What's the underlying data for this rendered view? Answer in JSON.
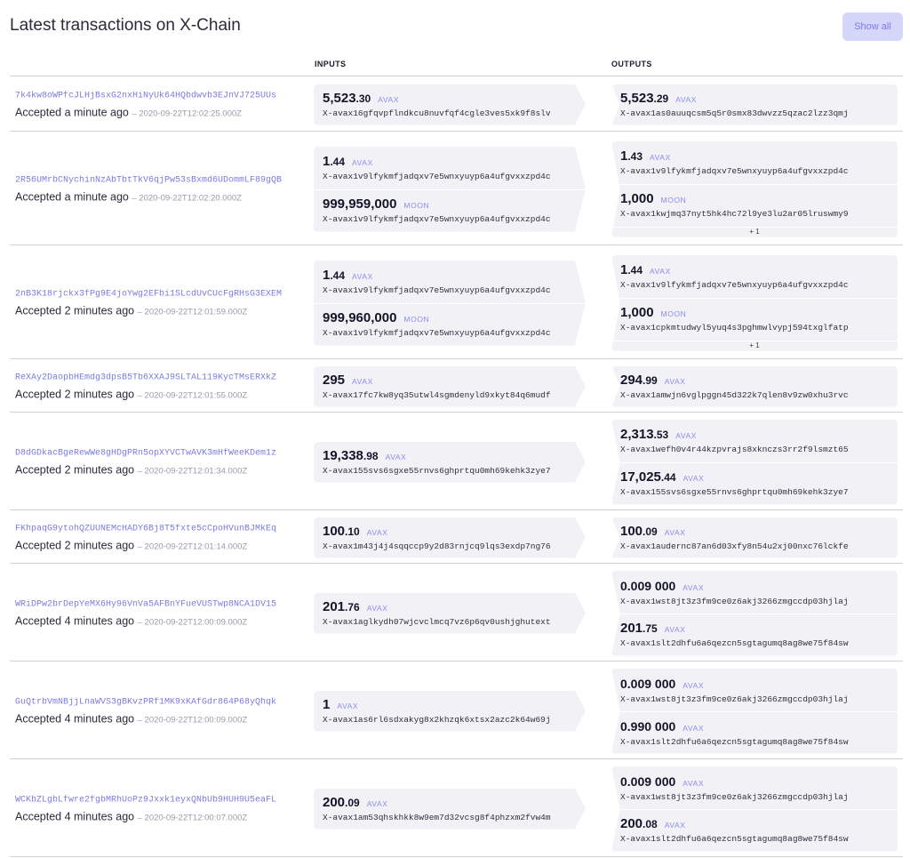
{
  "header": {
    "title": "Latest transactions on X-Chain",
    "show_all_label": "Show all"
  },
  "columns": {
    "inputs": "INPUTS",
    "outputs": "OUTPUTS"
  },
  "transactions": [
    {
      "id": "7k4kw8oWPfcJLHjBsxG2nxHiNyUk64HQbdwvb3EJnVJ725UUs",
      "status": "Accepted a minute ago",
      "timestamp": "– 2020-09-22T12:02:25.000Z",
      "inputs": [
        {
          "amount_int": "5,523",
          "amount_dec": ".30",
          "symbol": "AVAX",
          "address": "X-avax16gfqvpflndkcu8nuvfqf4cgle3ves5xk9f8slv"
        }
      ],
      "outputs": [
        {
          "amount_int": "5,523",
          "amount_dec": ".29",
          "symbol": "AVAX",
          "address": "X-avax1as0auuqcsm5q5r0smx83dwvzz5qzac2lzz3qmj"
        }
      ]
    },
    {
      "id": "2R56UMrbCNychinNzAbTbtTkV6qjPw53sBxmd6UDommLF89gQB",
      "status": "Accepted a minute ago",
      "timestamp": "– 2020-09-22T12:02:20.000Z",
      "inputs": [
        {
          "amount_int": "1",
          "amount_dec": ".44",
          "symbol": "AVAX",
          "address": "X-avax1v9lfykmfjadqxv7e5wnxyuyp6a4ufgvxxzpd4c"
        },
        {
          "amount_int": "999,959,000",
          "amount_dec": "",
          "symbol": "MOON",
          "address": "X-avax1v9lfykmfjadqxv7e5wnxyuyp6a4ufgvxxzpd4c"
        }
      ],
      "outputs": [
        {
          "amount_int": "1",
          "amount_dec": ".43",
          "symbol": "AVAX",
          "address": "X-avax1v9lfykmfjadqxv7e5wnxyuyp6a4ufgvxxzpd4c"
        },
        {
          "amount_int": "1,000",
          "amount_dec": "",
          "symbol": "MOON",
          "address": "X-avax1kwjmq37nyt5hk4hc72l9ye3lu2ar05lruswmy9"
        }
      ],
      "more_outputs": "+ 1"
    },
    {
      "id": "2nB3K18rjckx3fPg9E4joYwg2EFbi1SLcdUvCUcFgRHsG3EXEM",
      "status": "Accepted 2 minutes ago",
      "timestamp": "– 2020-09-22T12:01:59.000Z",
      "inputs": [
        {
          "amount_int": "1",
          "amount_dec": ".44",
          "symbol": "AVAX",
          "address": "X-avax1v9lfykmfjadqxv7e5wnxyuyp6a4ufgvxxzpd4c"
        },
        {
          "amount_int": "999,960,000",
          "amount_dec": "",
          "symbol": "MOON",
          "address": "X-avax1v9lfykmfjadqxv7e5wnxyuyp6a4ufgvxxzpd4c"
        }
      ],
      "outputs": [
        {
          "amount_int": "1",
          "amount_dec": ".44",
          "symbol": "AVAX",
          "address": "X-avax1v9lfykmfjadqxv7e5wnxyuyp6a4ufgvxxzpd4c"
        },
        {
          "amount_int": "1,000",
          "amount_dec": "",
          "symbol": "MOON",
          "address": "X-avax1cpkmtudwyl5yuq4s3pghmwlvypj594txglfatp"
        }
      ],
      "more_outputs": "+ 1"
    },
    {
      "id": "ReXAy2DaopbHEmdg3dpsB5Tb6XXAJ9SLTAL119KycTMsERXkZ",
      "status": "Accepted 2 minutes ago",
      "timestamp": "– 2020-09-22T12:01:55.000Z",
      "inputs": [
        {
          "amount_int": "295",
          "amount_dec": "",
          "symbol": "AVAX",
          "address": "X-avax17fc7kw8yq35utwl4sgmdenyld9xkyt84q6mudf"
        }
      ],
      "outputs": [
        {
          "amount_int": "294",
          "amount_dec": ".99",
          "symbol": "AVAX",
          "address": "X-avax1amwjn6vglpggn45d322k7qlen8v9zw0xhu3rvc"
        }
      ]
    },
    {
      "id": "D8dGDkacBgeRewWe8gHDgPRn5opXYVCTwAVK3mHfWeeKDem1z",
      "status": "Accepted 2 minutes ago",
      "timestamp": "– 2020-09-22T12:01:34.000Z",
      "inputs": [
        {
          "amount_int": "19,338",
          "amount_dec": ".98",
          "symbol": "AVAX",
          "address": "X-avax155svs6sgxe55rnvs6ghprtqu0mh69kehk3zye7"
        }
      ],
      "outputs": [
        {
          "amount_int": "2,313",
          "amount_dec": ".53",
          "symbol": "AVAX",
          "address": "X-avax1wefh0v4r44kzpvrajs8xknczs3rr2f9lsmzt65"
        },
        {
          "amount_int": "17,025",
          "amount_dec": ".44",
          "symbol": "AVAX",
          "address": "X-avax155svs6sgxe55rnvs6ghprtqu0mh69kehk3zye7"
        }
      ]
    },
    {
      "id": "FKhpaqG9ytohQZUUNEMcHADY6Bj8T5fxte5cCpoHVunBJMkEq",
      "status": "Accepted 2 minutes ago",
      "timestamp": "– 2020-09-22T12:01:14.000Z",
      "inputs": [
        {
          "amount_int": "100",
          "amount_dec": ".10",
          "symbol": "AVAX",
          "address": "X-avax1m43j4j4sqqccp9y2d83rnjcq9lqs3exdp7ng76"
        }
      ],
      "outputs": [
        {
          "amount_int": "100",
          "amount_dec": ".09",
          "symbol": "AVAX",
          "address": "X-avax1audernc87an6d03xfy8n54u2xj00nxc76lckfe"
        }
      ]
    },
    {
      "id": "WRiDPw2brDepYeMX6Hy96VnVa5AFBnYFueVUSTwp8NCA1DV15",
      "status": "Accepted 4 minutes ago",
      "timestamp": "– 2020-09-22T12:00:09.000Z",
      "inputs": [
        {
          "amount_int": "201",
          "amount_dec": ".76",
          "symbol": "AVAX",
          "address": "X-avax1aglkydh07wjcvclmcq7vz6p6qv0ushjghutext"
        }
      ],
      "outputs": [
        {
          "amount_int": "0",
          "amount_dec": ".009 000",
          "symbol": "AVAX",
          "address": "X-avax1wst8jt3z3fm9ce0z6akj3266zmgccdp03hjlaj"
        },
        {
          "amount_int": "201",
          "amount_dec": ".75",
          "symbol": "AVAX",
          "address": "X-avax1slt2dhfu6a6qezcn5sgtagumq8ag8we75f84sw"
        }
      ]
    },
    {
      "id": "GuQtrbVmNBjjLnaWVS3gBKvzPRf1MK9xKAfGdr864P68yQhqk",
      "status": "Accepted 4 minutes ago",
      "timestamp": "– 2020-09-22T12:00:09.000Z",
      "inputs": [
        {
          "amount_int": "1",
          "amount_dec": "",
          "symbol": "AVAX",
          "address": "X-avax1as6rl6sdxakyg8x2khzqk6xtsx2azc2k64w69j"
        }
      ],
      "outputs": [
        {
          "amount_int": "0",
          "amount_dec": ".009 000",
          "symbol": "AVAX",
          "address": "X-avax1wst8jt3z3fm9ce0z6akj3266zmgccdp03hjlaj"
        },
        {
          "amount_int": "0",
          "amount_dec": ".990 000",
          "symbol": "AVAX",
          "address": "X-avax1slt2dhfu6a6qezcn5sgtagumq8ag8we75f84sw"
        }
      ]
    },
    {
      "id": "WCKbZLgbLfwre2fgbMRhUoPz9Jxxk1eyxQNbUb9HUH9U5eaFL",
      "status": "Accepted 4 minutes ago",
      "timestamp": "– 2020-09-22T12:00:07.000Z",
      "inputs": [
        {
          "amount_int": "200",
          "amount_dec": ".09",
          "symbol": "AVAX",
          "address": "X-avax1am53qhskhkk8w9em7d32vcsg8f4phzxm2fvw4m"
        }
      ],
      "outputs": [
        {
          "amount_int": "0",
          "amount_dec": ".009 000",
          "symbol": "AVAX",
          "address": "X-avax1wst8jt3z3fm9ce0z6akj3266zmgccdp03hjlaj"
        },
        {
          "amount_int": "200",
          "amount_dec": ".08",
          "symbol": "AVAX",
          "address": "X-avax1slt2dhfu6a6qezcn5sgtagumq8ag8we75f84sw"
        }
      ]
    }
  ]
}
